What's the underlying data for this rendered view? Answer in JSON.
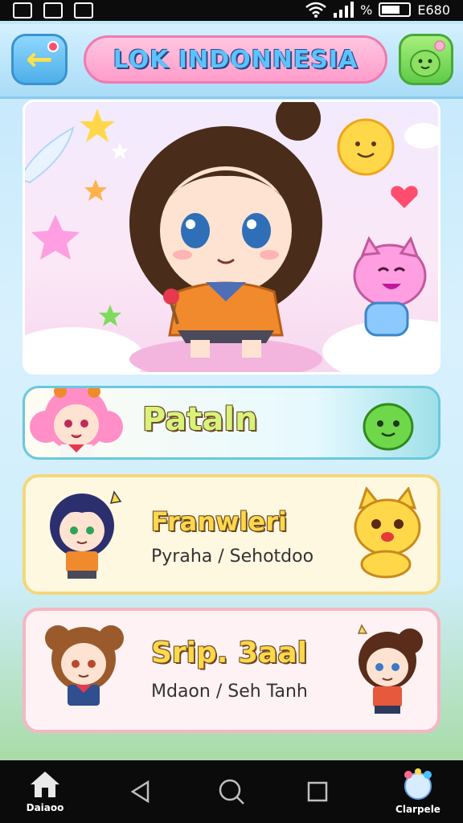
{
  "status_bar": {
    "battery_level": "%",
    "time": "E680"
  },
  "header": {
    "title": "LOK INDONNESIA"
  },
  "cards": [
    {
      "title": "Pataln"
    },
    {
      "title": "Franwleri",
      "subtitle": "Pyraha / Sehotdoo"
    },
    {
      "title": "Srip. 3aal",
      "subtitle": "Mdaon / Seh Tanh"
    }
  ],
  "nav": {
    "home_label": "Daiaoo",
    "profile_label": "Clarpele"
  },
  "colors": {
    "title_pill": "#ff9ccb",
    "back_button": "#4daee8",
    "menu_button": "#5fcb47",
    "card_1_border": "#69c8df",
    "card_2_border": "#f4d77a",
    "card_3_border": "#f6b6c4"
  }
}
